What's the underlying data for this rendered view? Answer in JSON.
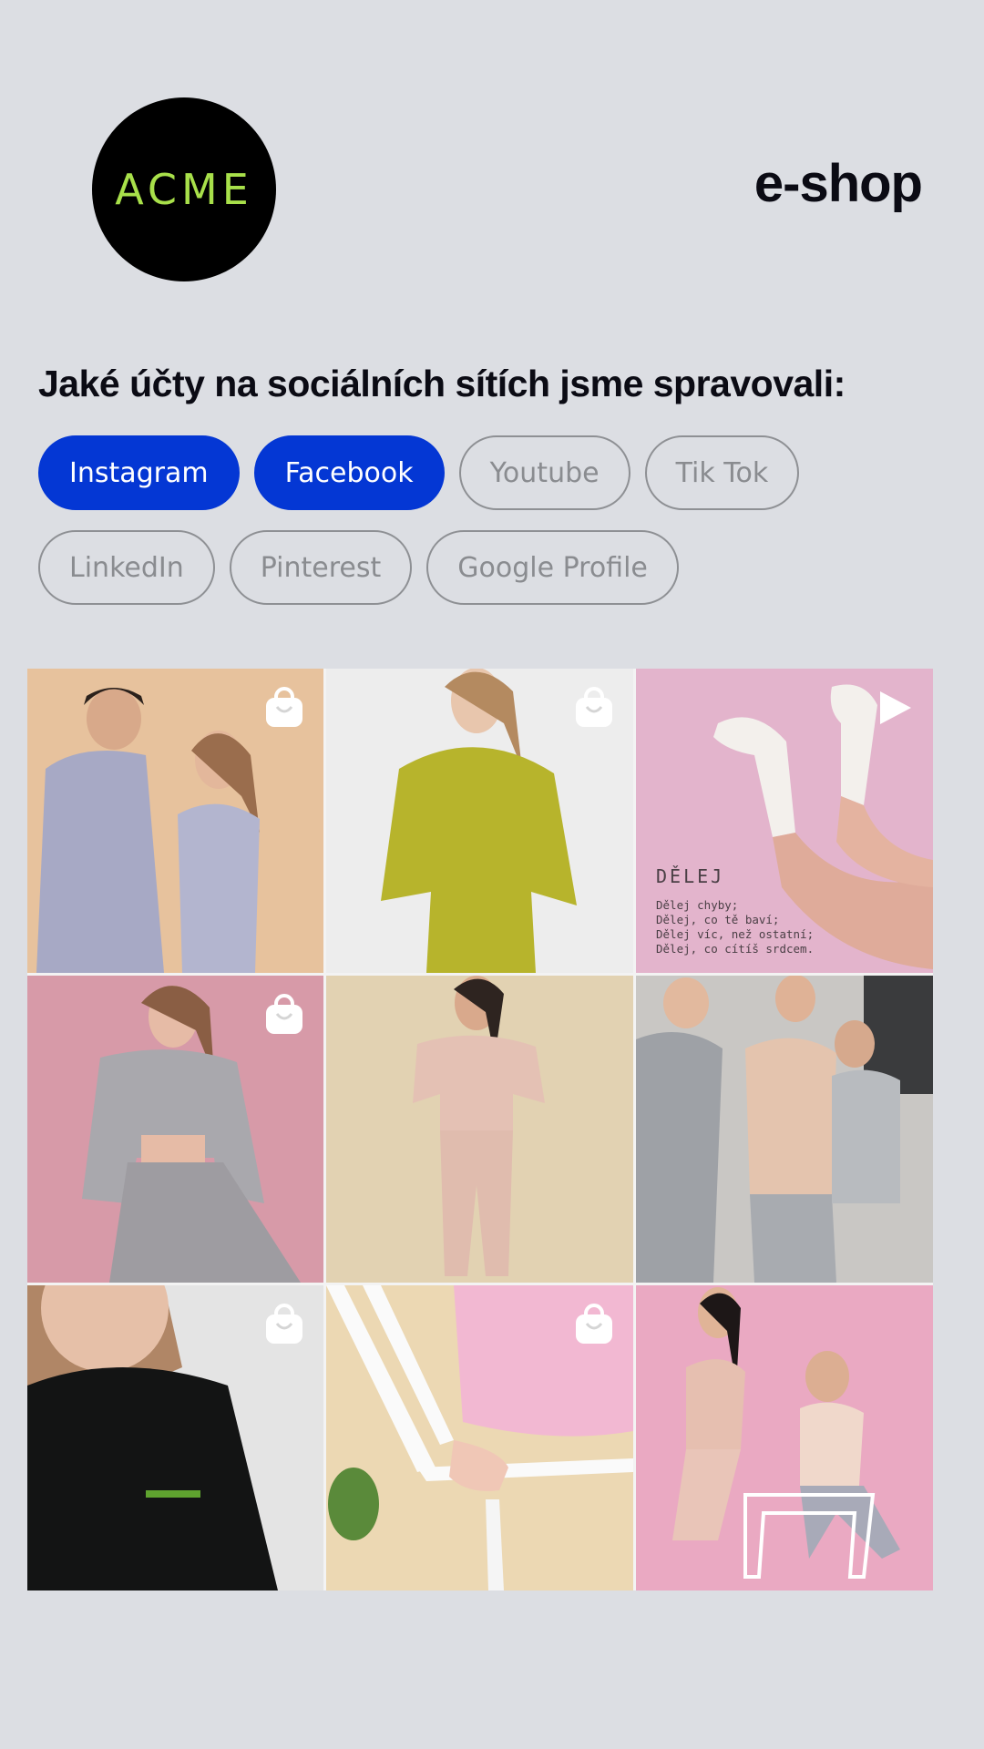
{
  "brand": {
    "logo_text": "ACME",
    "logo_color": "#a8e04a"
  },
  "header": {
    "title": "e-shop"
  },
  "section": {
    "heading": "Jaké účty na sociálních sítích jsme spravovali:"
  },
  "chips": [
    {
      "label": "Instagram",
      "active": true
    },
    {
      "label": "Facebook",
      "active": true
    },
    {
      "label": "Youtube",
      "active": false
    },
    {
      "label": "Tik Tok",
      "active": false
    },
    {
      "label": "LinkedIn",
      "active": false
    },
    {
      "label": "Pinterest",
      "active": false
    },
    {
      "label": "Google Profile",
      "active": false
    }
  ],
  "colors": {
    "background": "#dcdee3",
    "accent": "#0437d4",
    "chip_inactive": "#8a8c90"
  },
  "posts": [
    {
      "badge": "shopping-bag-icon",
      "subject": "couple in lavender sweatsuits",
      "bg": "#e7c29d"
    },
    {
      "badge": "shopping-bag-icon",
      "subject": "woman in olive sweatsuit",
      "bg": "#ededed"
    },
    {
      "badge": "play-icon",
      "subject": "socks on pink background",
      "bg": "#e3b4cc",
      "text": {
        "head": "DĚLEJ",
        "lines": [
          "Dělej chyby;",
          "Dělej, co tě baví;",
          "Dělej víc, než ostatní;",
          "Dělej, co cítíš srdcem."
        ]
      }
    },
    {
      "badge": "shopping-bag-icon",
      "subject": "woman in grey set on pink",
      "bg": "#d79aa8"
    },
    {
      "badge": "",
      "subject": "woman in pink sweatsuit",
      "bg": "#e2d2b2"
    },
    {
      "badge": "",
      "subject": "friends laughing outdoors",
      "bg": "#c9c7c4"
    },
    {
      "badge": "shopping-bag-icon",
      "subject": "woman in black hoodie",
      "bg": "#e4e4e4"
    },
    {
      "badge": "shopping-bag-icon",
      "subject": "pink sleeve on white chair",
      "bg": "#ecd8b3"
    },
    {
      "badge": "",
      "subject": "couple on white chair pink backdrop",
      "bg": "#eaa9c2"
    }
  ]
}
